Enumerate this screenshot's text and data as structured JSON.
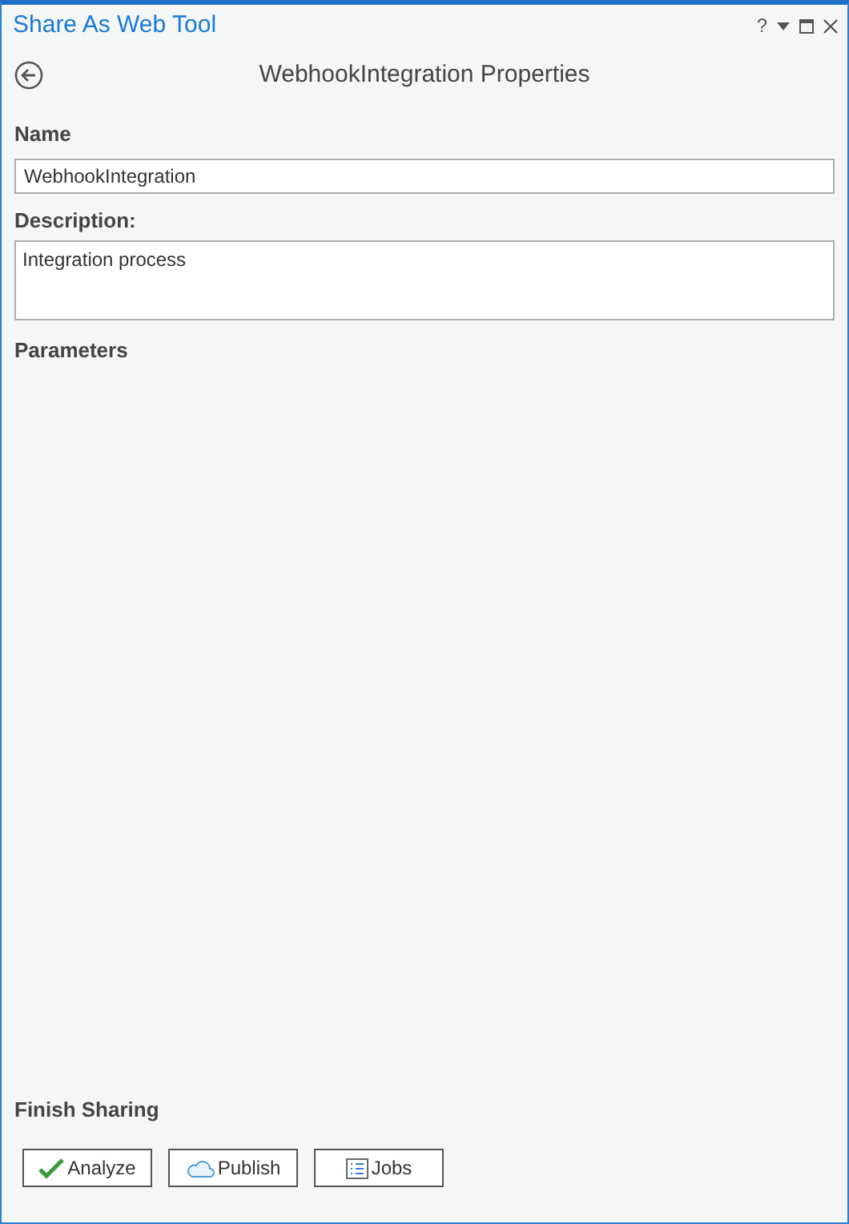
{
  "pane": {
    "title": "Share As Web Tool",
    "controls": [
      "?"
    ]
  },
  "header": {
    "title": "WebhookIntegration Properties"
  },
  "name": {
    "label": "Name",
    "value": "WebhookIntegration"
  },
  "description": {
    "label": "Description:",
    "value": "Integration process"
  },
  "parameters": {
    "label": "Parameters"
  },
  "finish": {
    "label": "Finish Sharing",
    "buttons": [
      {
        "kind": "analyze",
        "label": "Analyze"
      },
      {
        "kind": "publish",
        "label": "Publish"
      },
      {
        "kind": "jobs",
        "label": "Jobs"
      }
    ]
  }
}
